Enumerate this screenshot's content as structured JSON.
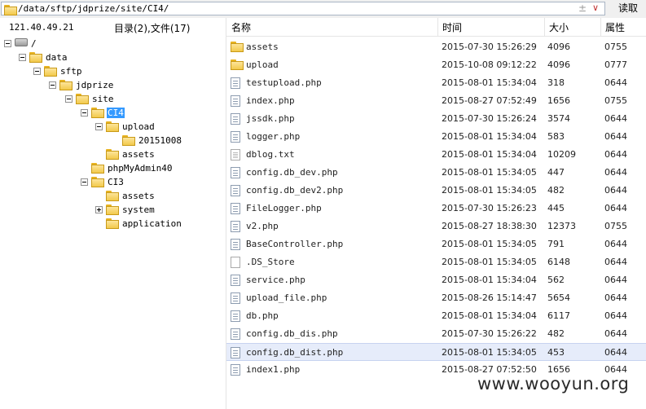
{
  "address": {
    "path": "/data/sftp/jdprize/site/CI4/",
    "plus_glyph": "±",
    "dropdown_glyph": "∨",
    "read_label": "读取"
  },
  "left": {
    "host": "121.40.49.21",
    "dir_count": "目录(2),文件(17)"
  },
  "tree": [
    {
      "label": "/",
      "toggle": "minus",
      "icon": "drive-icon"
    },
    {
      "label": "data",
      "toggle": "minus",
      "icon": "folder-icon"
    },
    {
      "label": "sftp",
      "toggle": "minus",
      "icon": "folder-icon"
    },
    {
      "label": "jdprize",
      "toggle": "minus",
      "icon": "folder-icon"
    },
    {
      "label": "site",
      "toggle": "minus",
      "icon": "folder-icon"
    },
    {
      "label": "CI4",
      "toggle": "minus",
      "icon": "folder-icon",
      "selected": true
    },
    {
      "label": "upload",
      "toggle": "minus",
      "icon": "folder-icon"
    },
    {
      "label": "20151008",
      "toggle": "",
      "icon": "folder-icon"
    },
    {
      "label": "assets",
      "toggle": "",
      "icon": "folder-icon"
    },
    {
      "label": "phpMyAdmin40",
      "toggle": "",
      "icon": "folder-icon"
    },
    {
      "label": "CI3",
      "toggle": "minus",
      "icon": "folder-icon"
    },
    {
      "label": "assets",
      "toggle": "",
      "icon": "folder-icon"
    },
    {
      "label": "system",
      "toggle": "plus",
      "icon": "folder-icon"
    },
    {
      "label": "application",
      "toggle": "",
      "icon": "folder-icon"
    }
  ],
  "columns": {
    "name": "名称",
    "time": "时间",
    "size": "大小",
    "attr": "属性"
  },
  "files": [
    {
      "name": "assets",
      "time": "2015-07-30 15:26:29",
      "size": "4096",
      "attr": "0755",
      "icon": "folder-icon"
    },
    {
      "name": "upload",
      "time": "2015-10-08 09:12:22",
      "size": "4096",
      "attr": "0777",
      "icon": "folder-icon"
    },
    {
      "name": "testupload.php",
      "time": "2015-08-01 15:34:04",
      "size": "318",
      "attr": "0644",
      "icon": "php-file-icon"
    },
    {
      "name": "index.php",
      "time": "2015-08-27 07:52:49",
      "size": "1656",
      "attr": "0755",
      "icon": "php-file-icon"
    },
    {
      "name": "jssdk.php",
      "time": "2015-07-30 15:26:24",
      "size": "3574",
      "attr": "0644",
      "icon": "php-file-icon"
    },
    {
      "name": "logger.php",
      "time": "2015-08-01 15:34:04",
      "size": "583",
      "attr": "0644",
      "icon": "php-file-icon"
    },
    {
      "name": "dblog.txt",
      "time": "2015-08-01 15:34:04",
      "size": "10209",
      "attr": "0644",
      "icon": "text-file-icon"
    },
    {
      "name": "config.db_dev.php",
      "time": "2015-08-01 15:34:05",
      "size": "447",
      "attr": "0644",
      "icon": "php-file-icon"
    },
    {
      "name": "config.db_dev2.php",
      "time": "2015-08-01 15:34:05",
      "size": "482",
      "attr": "0644",
      "icon": "php-file-icon"
    },
    {
      "name": "FileLogger.php",
      "time": "2015-07-30 15:26:23",
      "size": "445",
      "attr": "0644",
      "icon": "php-file-icon"
    },
    {
      "name": "v2.php",
      "time": "2015-08-27 18:38:30",
      "size": "12373",
      "attr": "0755",
      "icon": "php-file-icon"
    },
    {
      "name": "BaseController.php",
      "time": "2015-08-01 15:34:05",
      "size": "791",
      "attr": "0644",
      "icon": "php-file-icon"
    },
    {
      "name": ".DS_Store",
      "time": "2015-08-01 15:34:05",
      "size": "6148",
      "attr": "0644",
      "icon": "blank-file-icon"
    },
    {
      "name": "service.php",
      "time": "2015-08-01 15:34:04",
      "size": "562",
      "attr": "0644",
      "icon": "php-file-icon"
    },
    {
      "name": "upload_file.php",
      "time": "2015-08-26 15:14:47",
      "size": "5654",
      "attr": "0644",
      "icon": "php-file-icon"
    },
    {
      "name": "db.php",
      "time": "2015-08-01 15:34:04",
      "size": "6117",
      "attr": "0644",
      "icon": "php-file-icon"
    },
    {
      "name": "config.db_dis.php",
      "time": "2015-07-30 15:26:22",
      "size": "482",
      "attr": "0644",
      "icon": "php-file-icon"
    },
    {
      "name": "config.db_dist.php",
      "time": "2015-08-01 15:34:05",
      "size": "453",
      "attr": "0644",
      "icon": "php-file-icon",
      "selected": true
    },
    {
      "name": "index1.php",
      "time": "2015-08-27 07:52:50",
      "size": "1656",
      "attr": "0644",
      "icon": "php-file-icon"
    }
  ],
  "watermark": "www.wooyun.org",
  "colors": {
    "selection": "#3399ff",
    "row_selection": "#e6ecfa",
    "folder": "#f2c94c"
  }
}
